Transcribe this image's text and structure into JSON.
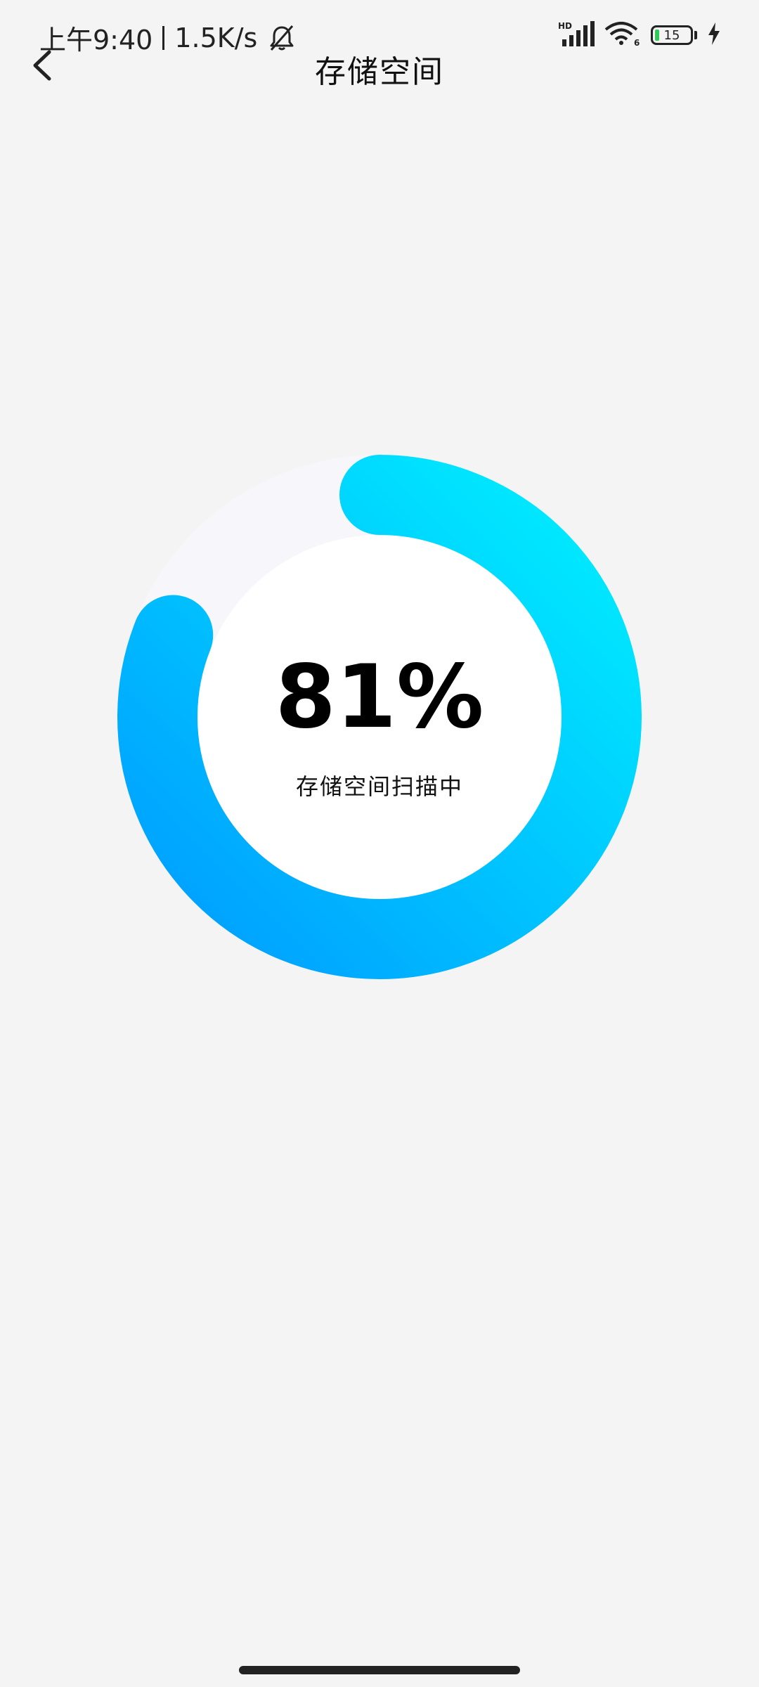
{
  "status_bar": {
    "time": "上午9:40",
    "net_speed": "1.5K/s",
    "battery_level": "15",
    "icons": [
      "bell-off-icon",
      "signal-icon",
      "wifi-icon",
      "battery-icon",
      "charging-icon"
    ],
    "battery_fill_color": "#34c759"
  },
  "header": {
    "title": "存储空间",
    "back_icon": "chevron-left-icon"
  },
  "progress": {
    "percent_text": "81%",
    "percent_value": 81,
    "status_text": "存储空间扫描中",
    "gradient_start": "#009dff",
    "gradient_end": "#00eeff",
    "track_color": "#f7f7fb"
  }
}
